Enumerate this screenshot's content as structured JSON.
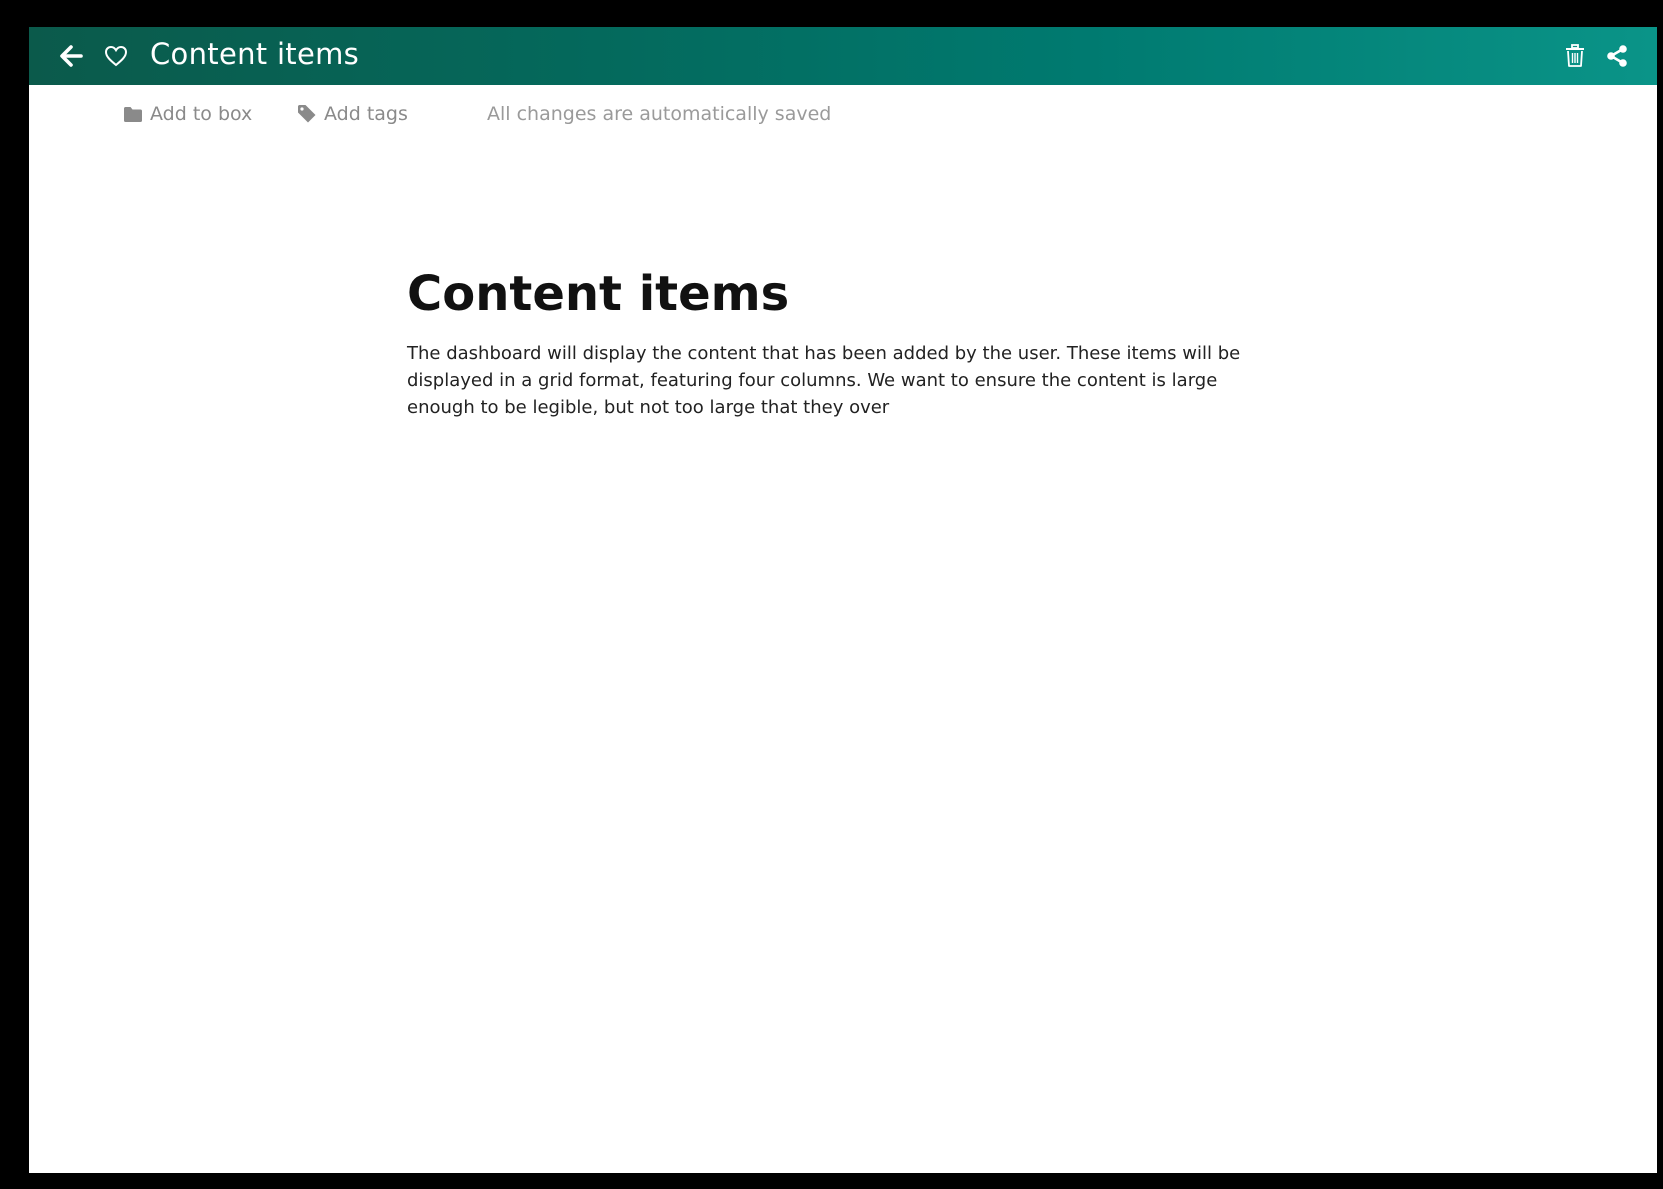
{
  "header": {
    "title": "Content items",
    "back_icon": "arrow-left-icon",
    "favorite_icon": "heart-outline-icon",
    "delete_icon": "trash-icon",
    "share_icon": "share-icon",
    "gradient_colors": [
      "#0b5a4b",
      "#04695c",
      "#007a70",
      "#0a9488"
    ]
  },
  "toolbar": {
    "add_to_box_label": "Add to box",
    "add_to_box_icon": "folder-icon",
    "add_tags_label": "Add tags",
    "add_tags_icon": "tag-icon",
    "status_text": "All changes are automatically saved"
  },
  "document": {
    "title": "Content items",
    "body": "The dashboard will display the content that has been added by the user. These items will be displayed in a grid format, featuring four columns. We want to ensure the content is large enough to be legible, but not too large that they over"
  }
}
